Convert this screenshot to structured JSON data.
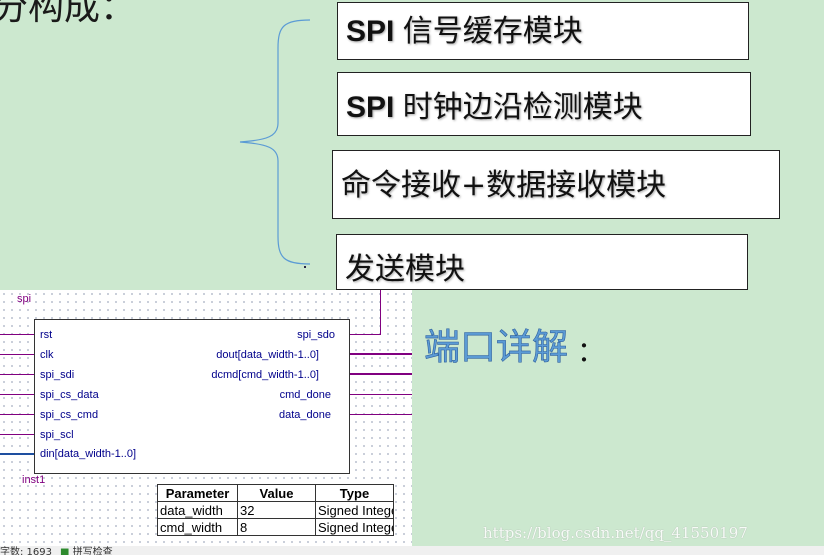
{
  "slide": {
    "heading": "分构成：",
    "modules": [
      {
        "prefix": "SPI ",
        "text": "信号缓存模块"
      },
      {
        "prefix": "SPI ",
        "text": "时钟边沿检测模块"
      },
      {
        "prefix": "",
        "text": "命令接收+数据接收模块"
      },
      {
        "prefix": "",
        "text": "发送模块"
      }
    ],
    "port_title": "端口详解",
    "colon": "："
  },
  "schematic": {
    "module_name": "spi",
    "instance_name": "inst1",
    "inputs": [
      "rst",
      "clk",
      "spi_sdi",
      "spi_cs_data",
      "spi_cs_cmd",
      "spi_scl",
      "din[data_width-1..0]"
    ],
    "outputs": [
      "spi_sdo",
      "dout[data_width-1..0]",
      "dcmd[cmd_width-1..0]",
      "cmd_done",
      "data_done"
    ]
  },
  "params_table": {
    "headers": [
      "Parameter",
      "Value",
      "Type"
    ],
    "rows": [
      [
        "data_width",
        "32",
        "Signed Integer"
      ],
      [
        "cmd_width",
        "8",
        "Signed Integer"
      ]
    ]
  },
  "watermark": "https://blog.csdn.net/qq_41550197",
  "statusbar": {
    "word_count": "字数: 1693",
    "spell_check": "拼写检查"
  },
  "colors": {
    "slide_background": "#cce8cf",
    "port_title": "#5b9bd5",
    "wire": "#800080",
    "port_text": "#00008b"
  }
}
